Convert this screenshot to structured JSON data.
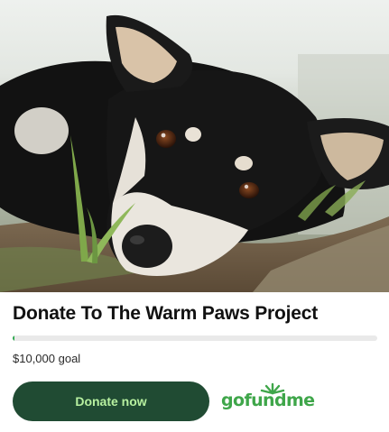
{
  "campaign": {
    "title": "Donate To The Warm Paws Project",
    "goal_label": "$10,000 goal",
    "progress_fraction": 0.006
  },
  "actions": {
    "donate_label": "Donate now"
  },
  "brand": {
    "logo_text": "gofundme",
    "accent": "#3fa64a",
    "button_bg": "#204b33",
    "button_text": "#b7f0a0"
  },
  "hero": {
    "icon": "dog-photo"
  }
}
